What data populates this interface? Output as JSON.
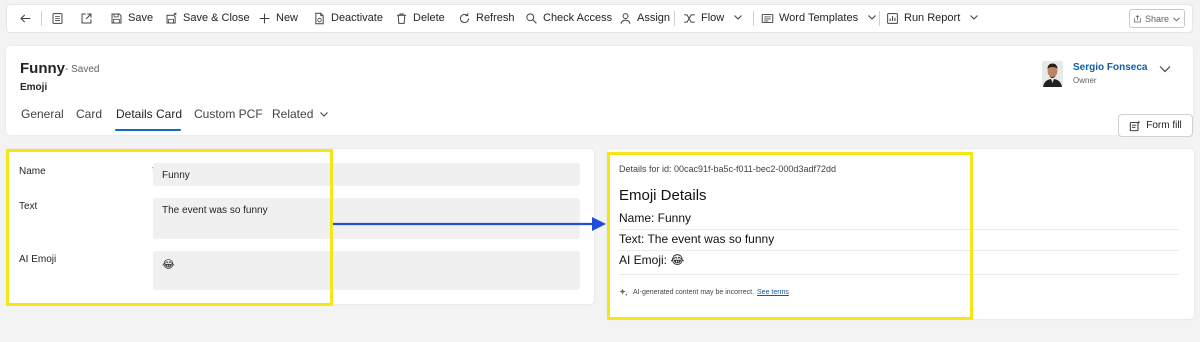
{
  "command_bar": {
    "save": "Save",
    "save_close": "Save & Close",
    "new": "New",
    "deactivate": "Deactivate",
    "delete": "Delete",
    "refresh": "Refresh",
    "check_access": "Check Access",
    "assign": "Assign",
    "flow": "Flow",
    "word_templates": "Word Templates",
    "run_report": "Run Report",
    "share": "Share"
  },
  "record": {
    "title": "Funny",
    "status": "- Saved",
    "entity": "Emoji"
  },
  "owner": {
    "name": "Sergio Fonseca",
    "role": "Owner"
  },
  "tabs": [
    "General",
    "Card",
    "Details Card",
    "Custom PCF",
    "Related"
  ],
  "active_tab": "Details Card",
  "form_fill": "Form fill",
  "form": {
    "name_label": "Name",
    "name_required": "*",
    "name_value": "Funny",
    "text_label": "Text",
    "text_value": "The event was so funny",
    "ai_emoji_label": "AI Emoji",
    "ai_emoji_value": "😂"
  },
  "details": {
    "id_line": "Details for id: 00cac91f-ba5c-f011-bec2-000d3adf72dd",
    "heading": "Emoji Details",
    "name_line": "Name: Funny",
    "text_line": "Text: The event was so funny",
    "emoji_line": "AI Emoji: 😂",
    "ai_disclaimer": "AI-generated content may be incorrect.",
    "terms_link": "See terms"
  },
  "colors": {
    "highlight": "#f5e616",
    "arrow": "#1f4fd8",
    "accent": "#0f6cbd"
  }
}
